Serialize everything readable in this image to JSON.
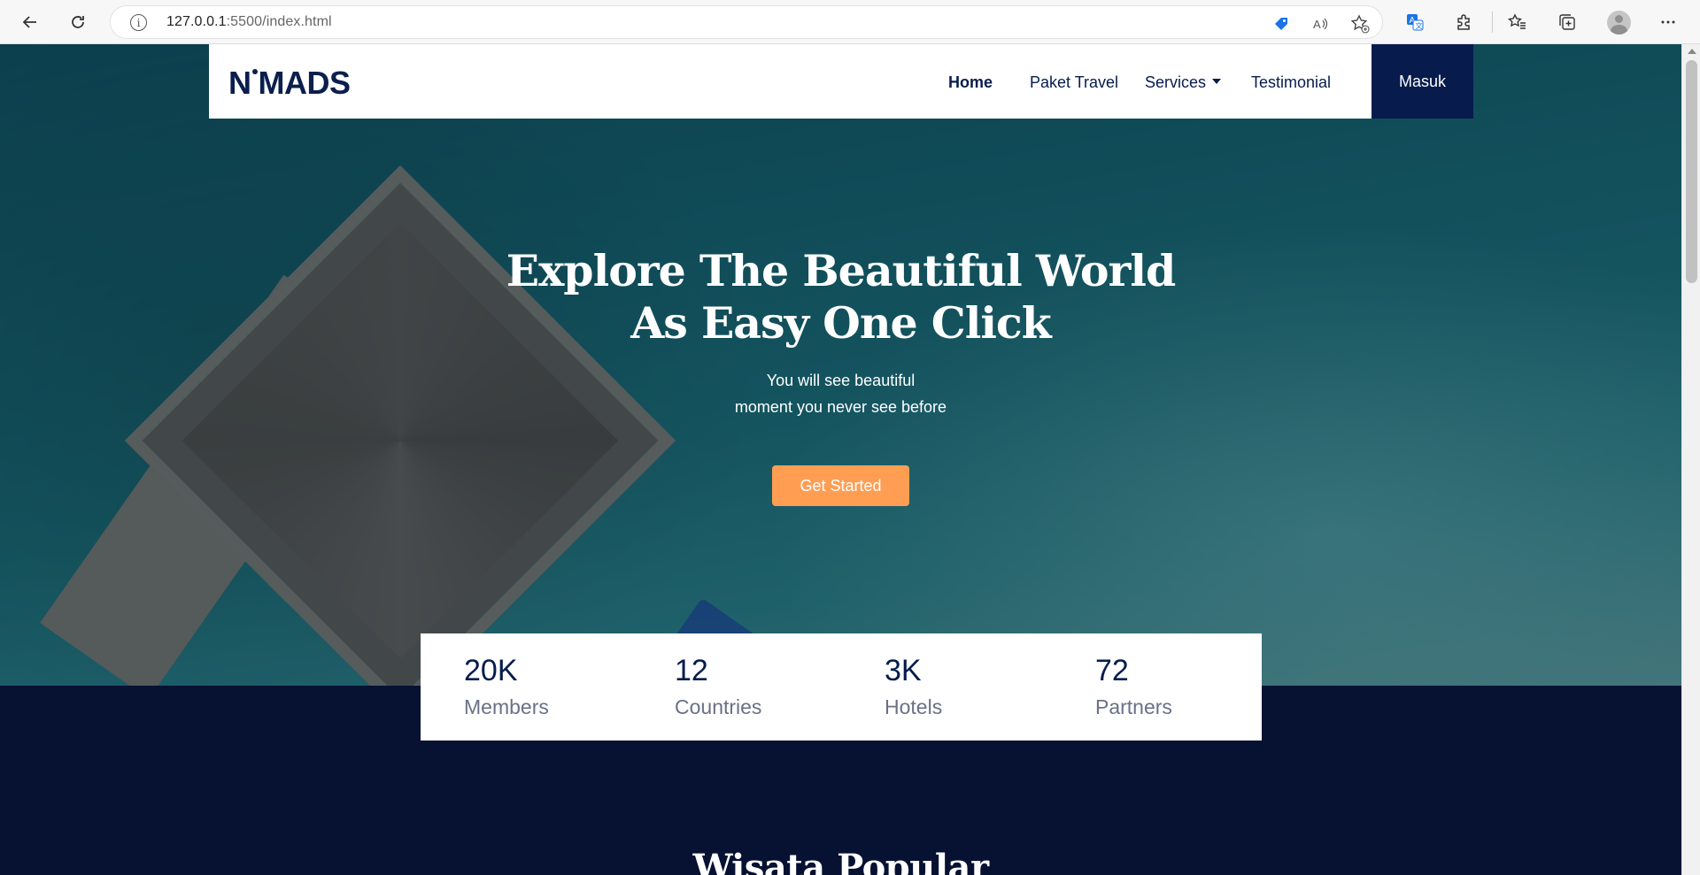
{
  "browser": {
    "url_host": "127.0.0.1",
    "url_rest": ":5500/index.html"
  },
  "navbar": {
    "logo": "N·MADS",
    "logo_left": "N",
    "logo_right": "MADS",
    "items": [
      {
        "label": "Home",
        "active": true
      },
      {
        "label": "Paket Travel"
      },
      {
        "label": "Services",
        "dropdown": true
      },
      {
        "label": "Testimonial"
      }
    ],
    "login_label": "Masuk"
  },
  "hero": {
    "title_line1": "Explore The Beautiful World",
    "title_line2": "As Easy One Click",
    "subtitle_line1": "You will see beautiful",
    "subtitle_line2": "moment you never see before",
    "cta_label": "Get Started"
  },
  "stats": [
    {
      "value": "20K",
      "label": "Members"
    },
    {
      "value": "12",
      "label": "Countries"
    },
    {
      "value": "3K",
      "label": "Hotels"
    },
    {
      "value": "72",
      "label": "Partners"
    }
  ],
  "section": {
    "title": "Wisata Popular"
  },
  "colors": {
    "primary": "#071c4d",
    "accent": "#ff9e53",
    "dark_section": "#071233"
  }
}
